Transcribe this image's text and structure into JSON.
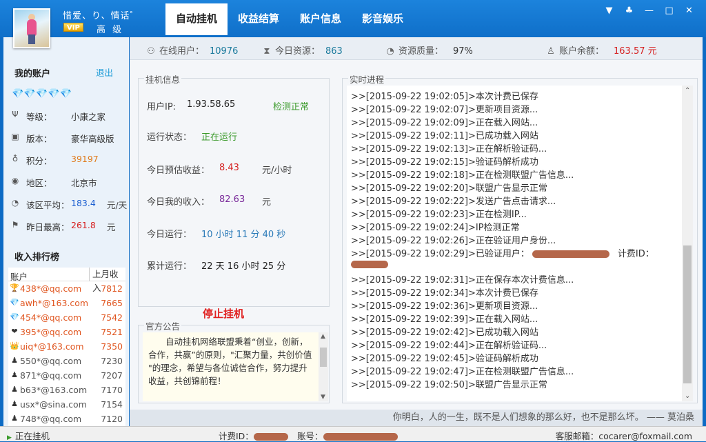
{
  "user": {
    "name": "惜爱、り、情话゜",
    "vip": "VIP",
    "level": "高 级"
  },
  "tabs": [
    {
      "label": "自动挂机"
    },
    {
      "label": "收益结算"
    },
    {
      "label": "账户信息"
    },
    {
      "label": "影音娱乐"
    }
  ],
  "window_buttons": [
    {
      "glyph": "▼"
    },
    {
      "glyph": "♣"
    },
    {
      "glyph": "—"
    },
    {
      "glyph": "□"
    },
    {
      "glyph": "✕"
    }
  ],
  "stats": {
    "online_label": "在线用户：",
    "online_value": "10976",
    "resources_label": "今日资源：",
    "resources_value": "863",
    "quality_label": "资源质量：",
    "quality_value": "97%",
    "balance_label": "账户余额：",
    "balance_value": "163.57 元"
  },
  "account": {
    "title": "我的账户",
    "logout": "退出",
    "diamonds": "💎💎💎💎💎",
    "rows": [
      {
        "icon": "Ψ",
        "label": "等级：",
        "value": "小康之家",
        "unit": "",
        "color": "#333333"
      },
      {
        "icon": "▣",
        "label": "版本：",
        "value": "豪华高级版",
        "unit": "",
        "color": "#333333"
      },
      {
        "icon": "♁",
        "label": "积分：",
        "value": "39197",
        "unit": "",
        "color": "#e07a1a"
      },
      {
        "icon": "◉",
        "label": "地区：",
        "value": "北京市",
        "unit": "",
        "color": "#333333"
      },
      {
        "icon": "◔",
        "label": "该区平均：",
        "value": "183.4",
        "unit": "元/天",
        "color": "#1c5fd1"
      },
      {
        "icon": "⚑",
        "label": "昨日最高：",
        "value": "261.8",
        "unit": "元",
        "color": "#d62020"
      }
    ]
  },
  "ranking": {
    "title": "收入排行榜",
    "col_account": "账户",
    "col_income": "上月收入",
    "rows": [
      {
        "icon": "🏆",
        "account": "438*@qq.com",
        "income": "7812",
        "color": "#e0551f"
      },
      {
        "icon": "💎",
        "account": "awh*@163.com",
        "income": "7665",
        "color": "#e0551f"
      },
      {
        "icon": "💎",
        "account": "454*@qq.com",
        "income": "7542",
        "color": "#e0551f"
      },
      {
        "icon": "❤",
        "account": "395*@qq.com",
        "income": "7521",
        "color": "#e0551f"
      },
      {
        "icon": "👑",
        "account": "uiq*@163.com",
        "income": "7350",
        "color": "#e0551f"
      },
      {
        "icon": "♟",
        "account": "550*@qq.com",
        "income": "7230",
        "color": "#555555"
      },
      {
        "icon": "♟",
        "account": "871*@qq.com",
        "income": "7207",
        "color": "#555555"
      },
      {
        "icon": "♟",
        "account": "b63*@163.com",
        "income": "7170",
        "color": "#555555"
      },
      {
        "icon": "♟",
        "account": "usx*@sina.com",
        "income": "7154",
        "color": "#555555"
      },
      {
        "icon": "♟",
        "account": "748*@qq.com",
        "income": "7120",
        "color": "#555555"
      }
    ]
  },
  "hang": {
    "title": "挂机信息",
    "ip_label": "用户IP:",
    "ip_value": "1.93.58.65",
    "ip_status": "检测正常",
    "run_label": "运行状态：",
    "run_value": "正在运行",
    "est_label": "今日预估收益：",
    "est_value": "8.43",
    "est_unit": "元/小时",
    "income_label": "今日我的收入：",
    "income_value": "82.63",
    "income_unit": "元",
    "today_label": "今日运行：",
    "today_value": "10 小时 11 分 40 秒",
    "total_label": "累计运行：",
    "total_value": "22 天 16 小时 25 分",
    "stop_button": "停止挂机"
  },
  "notice": {
    "title": "官方公告",
    "text": "自动挂机网络联盟秉着“创业，创新，合作，共赢”的原则，\"汇聚力量，共创价值 \"的理念，希望与各位诚信合作，努力提升收益，共创锦前程！"
  },
  "log": {
    "title": "实时进程",
    "lines": [
      ">>[2015-09-22 19:02:05]>本次计费已保存",
      ">>[2015-09-22 19:02:07]>更新项目资源...",
      ">>[2015-09-22 19:02:09]>正在载入网站...",
      ">>[2015-09-22 19:02:11]>已成功载入网站",
      ">>[2015-09-22 19:02:13]>正在解析验证码...",
      ">>[2015-09-22 19:02:15]>验证码解析成功",
      ">>[2015-09-22 19:02:18]>正在检测联盟广告信息...",
      ">>[2015-09-22 19:02:20]>联盟广告显示正常",
      ">>[2015-09-22 19:02:22]>发送广告点击请求...",
      ">>[2015-09-22 19:02:23]>正在检测IP...",
      ">>[2015-09-22 19:02:24]>IP检测正常",
      ">>[2015-09-22 19:02:26]>正在验证用户身份...",
      ">>[2015-09-22 19:02:29]>已验证用户：",
      "",
      ">>[2015-09-22 19:02:31]>正在保存本次计费信息...",
      ">>[2015-09-22 19:02:34]>本次计费已保存",
      ">>[2015-09-22 19:02:36]>更新项目资源...",
      ">>[2015-09-22 19:02:39]>正在载入网站...",
      ">>[2015-09-22 19:02:42]>已成功载入网站",
      ">>[2015-09-22 19:02:44]>正在解析验证码...",
      ">>[2015-09-22 19:02:45]>验证码解析成功",
      ">>[2015-09-22 19:02:47]>正在检测联盟广告信息...",
      ">>[2015-09-22 19:02:50]>联盟广告显示正常"
    ],
    "billing_label": "计费ID："
  },
  "footer": {
    "quote": "你明白，人的一生，既不是人们想象的那么好，也不是那么坏。 —— 莫泊桑",
    "status": "正在挂机",
    "billing_label": "计费ID：",
    "account_label": "账号：",
    "email_label": "客服邮箱：",
    "email": "cocarer@foxmail.com"
  }
}
